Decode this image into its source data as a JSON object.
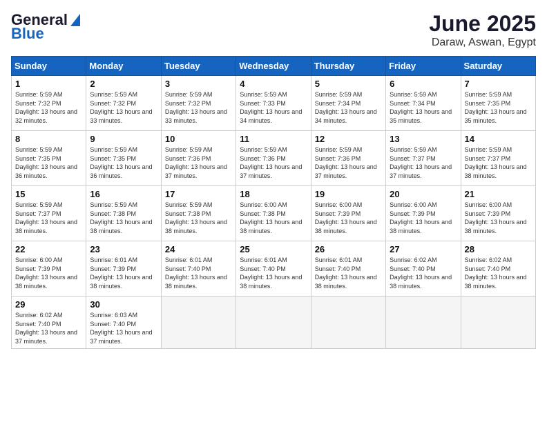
{
  "header": {
    "logo_general": "General",
    "logo_blue": "Blue",
    "month": "June 2025",
    "location": "Daraw, Aswan, Egypt"
  },
  "weekdays": [
    "Sunday",
    "Monday",
    "Tuesday",
    "Wednesday",
    "Thursday",
    "Friday",
    "Saturday"
  ],
  "weeks": [
    [
      {
        "day": "1",
        "sunrise": "Sunrise: 5:59 AM",
        "sunset": "Sunset: 7:32 PM",
        "daylight": "Daylight: 13 hours and 32 minutes."
      },
      {
        "day": "2",
        "sunrise": "Sunrise: 5:59 AM",
        "sunset": "Sunset: 7:32 PM",
        "daylight": "Daylight: 13 hours and 33 minutes."
      },
      {
        "day": "3",
        "sunrise": "Sunrise: 5:59 AM",
        "sunset": "Sunset: 7:32 PM",
        "daylight": "Daylight: 13 hours and 33 minutes."
      },
      {
        "day": "4",
        "sunrise": "Sunrise: 5:59 AM",
        "sunset": "Sunset: 7:33 PM",
        "daylight": "Daylight: 13 hours and 34 minutes."
      },
      {
        "day": "5",
        "sunrise": "Sunrise: 5:59 AM",
        "sunset": "Sunset: 7:34 PM",
        "daylight": "Daylight: 13 hours and 34 minutes."
      },
      {
        "day": "6",
        "sunrise": "Sunrise: 5:59 AM",
        "sunset": "Sunset: 7:34 PM",
        "daylight": "Daylight: 13 hours and 35 minutes."
      },
      {
        "day": "7",
        "sunrise": "Sunrise: 5:59 AM",
        "sunset": "Sunset: 7:35 PM",
        "daylight": "Daylight: 13 hours and 35 minutes."
      }
    ],
    [
      {
        "day": "8",
        "sunrise": "Sunrise: 5:59 AM",
        "sunset": "Sunset: 7:35 PM",
        "daylight": "Daylight: 13 hours and 36 minutes."
      },
      {
        "day": "9",
        "sunrise": "Sunrise: 5:59 AM",
        "sunset": "Sunset: 7:35 PM",
        "daylight": "Daylight: 13 hours and 36 minutes."
      },
      {
        "day": "10",
        "sunrise": "Sunrise: 5:59 AM",
        "sunset": "Sunset: 7:36 PM",
        "daylight": "Daylight: 13 hours and 37 minutes."
      },
      {
        "day": "11",
        "sunrise": "Sunrise: 5:59 AM",
        "sunset": "Sunset: 7:36 PM",
        "daylight": "Daylight: 13 hours and 37 minutes."
      },
      {
        "day": "12",
        "sunrise": "Sunrise: 5:59 AM",
        "sunset": "Sunset: 7:36 PM",
        "daylight": "Daylight: 13 hours and 37 minutes."
      },
      {
        "day": "13",
        "sunrise": "Sunrise: 5:59 AM",
        "sunset": "Sunset: 7:37 PM",
        "daylight": "Daylight: 13 hours and 37 minutes."
      },
      {
        "day": "14",
        "sunrise": "Sunrise: 5:59 AM",
        "sunset": "Sunset: 7:37 PM",
        "daylight": "Daylight: 13 hours and 38 minutes."
      }
    ],
    [
      {
        "day": "15",
        "sunrise": "Sunrise: 5:59 AM",
        "sunset": "Sunset: 7:37 PM",
        "daylight": "Daylight: 13 hours and 38 minutes."
      },
      {
        "day": "16",
        "sunrise": "Sunrise: 5:59 AM",
        "sunset": "Sunset: 7:38 PM",
        "daylight": "Daylight: 13 hours and 38 minutes."
      },
      {
        "day": "17",
        "sunrise": "Sunrise: 5:59 AM",
        "sunset": "Sunset: 7:38 PM",
        "daylight": "Daylight: 13 hours and 38 minutes."
      },
      {
        "day": "18",
        "sunrise": "Sunrise: 6:00 AM",
        "sunset": "Sunset: 7:38 PM",
        "daylight": "Daylight: 13 hours and 38 minutes."
      },
      {
        "day": "19",
        "sunrise": "Sunrise: 6:00 AM",
        "sunset": "Sunset: 7:39 PM",
        "daylight": "Daylight: 13 hours and 38 minutes."
      },
      {
        "day": "20",
        "sunrise": "Sunrise: 6:00 AM",
        "sunset": "Sunset: 7:39 PM",
        "daylight": "Daylight: 13 hours and 38 minutes."
      },
      {
        "day": "21",
        "sunrise": "Sunrise: 6:00 AM",
        "sunset": "Sunset: 7:39 PM",
        "daylight": "Daylight: 13 hours and 38 minutes."
      }
    ],
    [
      {
        "day": "22",
        "sunrise": "Sunrise: 6:00 AM",
        "sunset": "Sunset: 7:39 PM",
        "daylight": "Daylight: 13 hours and 38 minutes."
      },
      {
        "day": "23",
        "sunrise": "Sunrise: 6:01 AM",
        "sunset": "Sunset: 7:39 PM",
        "daylight": "Daylight: 13 hours and 38 minutes."
      },
      {
        "day": "24",
        "sunrise": "Sunrise: 6:01 AM",
        "sunset": "Sunset: 7:40 PM",
        "daylight": "Daylight: 13 hours and 38 minutes."
      },
      {
        "day": "25",
        "sunrise": "Sunrise: 6:01 AM",
        "sunset": "Sunset: 7:40 PM",
        "daylight": "Daylight: 13 hours and 38 minutes."
      },
      {
        "day": "26",
        "sunrise": "Sunrise: 6:01 AM",
        "sunset": "Sunset: 7:40 PM",
        "daylight": "Daylight: 13 hours and 38 minutes."
      },
      {
        "day": "27",
        "sunrise": "Sunrise: 6:02 AM",
        "sunset": "Sunset: 7:40 PM",
        "daylight": "Daylight: 13 hours and 38 minutes."
      },
      {
        "day": "28",
        "sunrise": "Sunrise: 6:02 AM",
        "sunset": "Sunset: 7:40 PM",
        "daylight": "Daylight: 13 hours and 38 minutes."
      }
    ],
    [
      {
        "day": "29",
        "sunrise": "Sunrise: 6:02 AM",
        "sunset": "Sunset: 7:40 PM",
        "daylight": "Daylight: 13 hours and 37 minutes."
      },
      {
        "day": "30",
        "sunrise": "Sunrise: 6:03 AM",
        "sunset": "Sunset: 7:40 PM",
        "daylight": "Daylight: 13 hours and 37 minutes."
      },
      null,
      null,
      null,
      null,
      null
    ]
  ]
}
